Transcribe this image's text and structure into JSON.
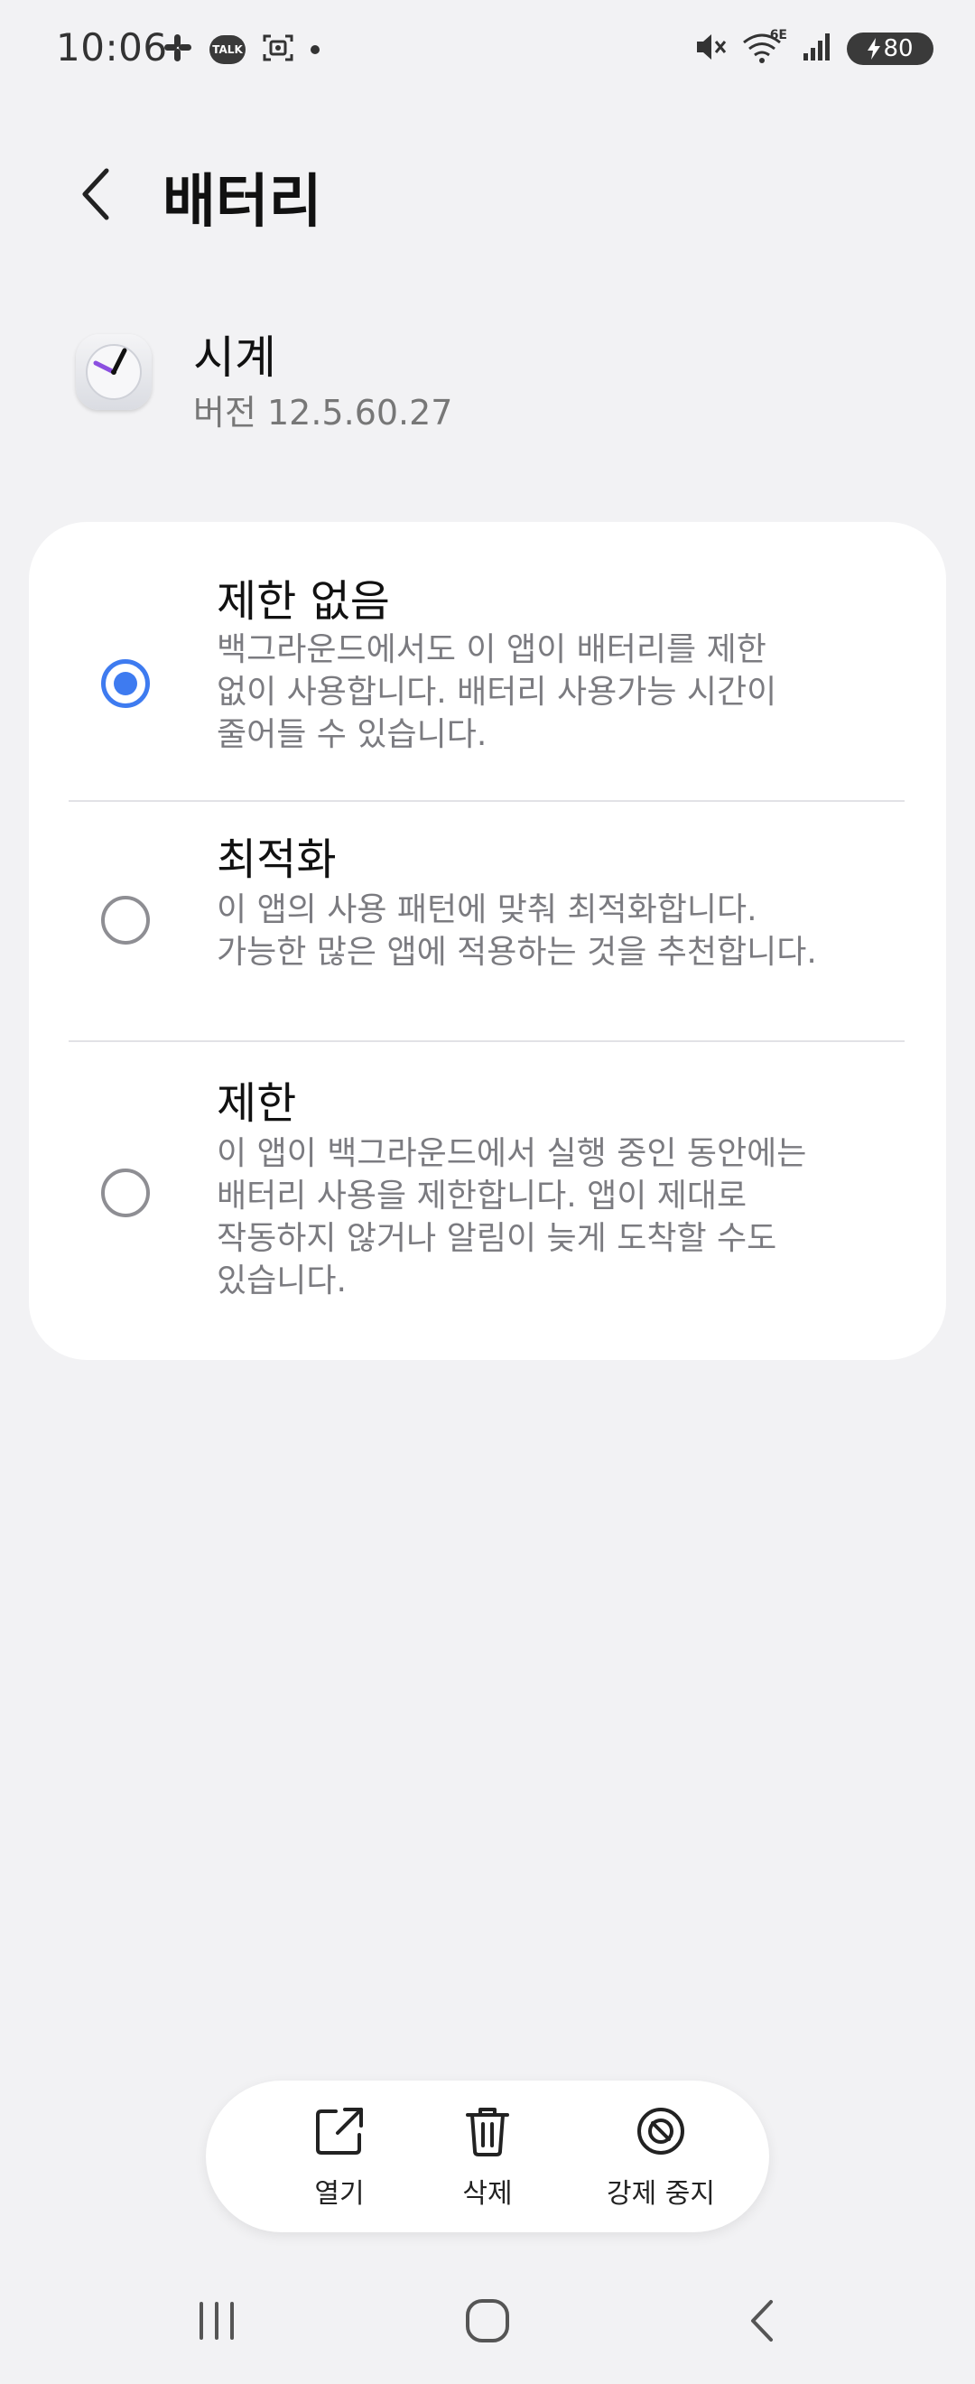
{
  "status_bar": {
    "time": "10:06",
    "talk_badge": "TALK",
    "network_label": "6E",
    "battery_level": "80"
  },
  "header": {
    "title": "배터리"
  },
  "app": {
    "name": "시계",
    "version": "버전 12.5.60.27",
    "icon": "clock-icon"
  },
  "options": [
    {
      "title": "제한 없음",
      "description": "백그라운드에서도 이 앱이 배터리를 제한\n없이 사용합니다. 배터리 사용가능 시간이\n줄어들 수 있습니다.",
      "selected": true
    },
    {
      "title": "최적화",
      "description": "이 앱의 사용 패턴에 맞춰 최적화합니다.\n가능한 많은 앱에 적용하는 것을 추천합니다.",
      "selected": false
    },
    {
      "title": "제한",
      "description": "이 앱이 백그라운드에서 실행 중인 동안에는\n배터리 사용을 제한합니다. 앱이 제대로\n작동하지 않거나 알림이 늦게 도착할 수도\n있습니다.",
      "selected": false
    }
  ],
  "actions": {
    "open_label": "열기",
    "delete_label": "삭제",
    "force_stop_label": "강제 중지"
  },
  "colors": {
    "accent": "#3e7bf0",
    "background": "#f2f2f4",
    "card": "#ffffff",
    "secondary_text": "#7b7b80"
  }
}
